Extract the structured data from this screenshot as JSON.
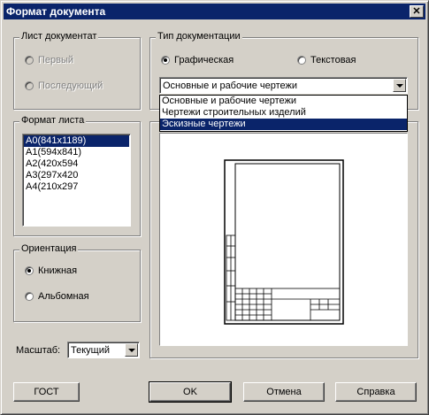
{
  "window": {
    "title": "Формат документа",
    "close_glyph": "✕"
  },
  "sheet_group": {
    "title": "Лист документат",
    "options": [
      "Первый",
      "Последующий"
    ]
  },
  "doc_type_group": {
    "title": "Тип документации",
    "options": [
      "Графическая",
      "Текстовая"
    ],
    "selected_value": "Основные и рабочие чертежи",
    "dropdown_options": [
      "Основные и рабочие чертежи",
      "Чертежи строительных изделий",
      "Эскизные чертежи"
    ]
  },
  "format_group": {
    "title": "Формат листа",
    "items": [
      "A0(841x1189)",
      "A1(594x841)",
      "A2(420x594",
      "A3(297x420",
      "A4(210x297"
    ]
  },
  "orientation_group": {
    "title": "Ориентация",
    "options": [
      "Книжная",
      "Альбомная"
    ]
  },
  "scale": {
    "label": "Масштаб:",
    "value": "Текущий"
  },
  "buttons": {
    "gost": "ГОСТ",
    "ok": "OK",
    "cancel": "Отмена",
    "help": "Справка"
  },
  "colors": {
    "titlebar": "#0a246a",
    "face": "#d4d0c8",
    "selection": "#0a246a"
  }
}
